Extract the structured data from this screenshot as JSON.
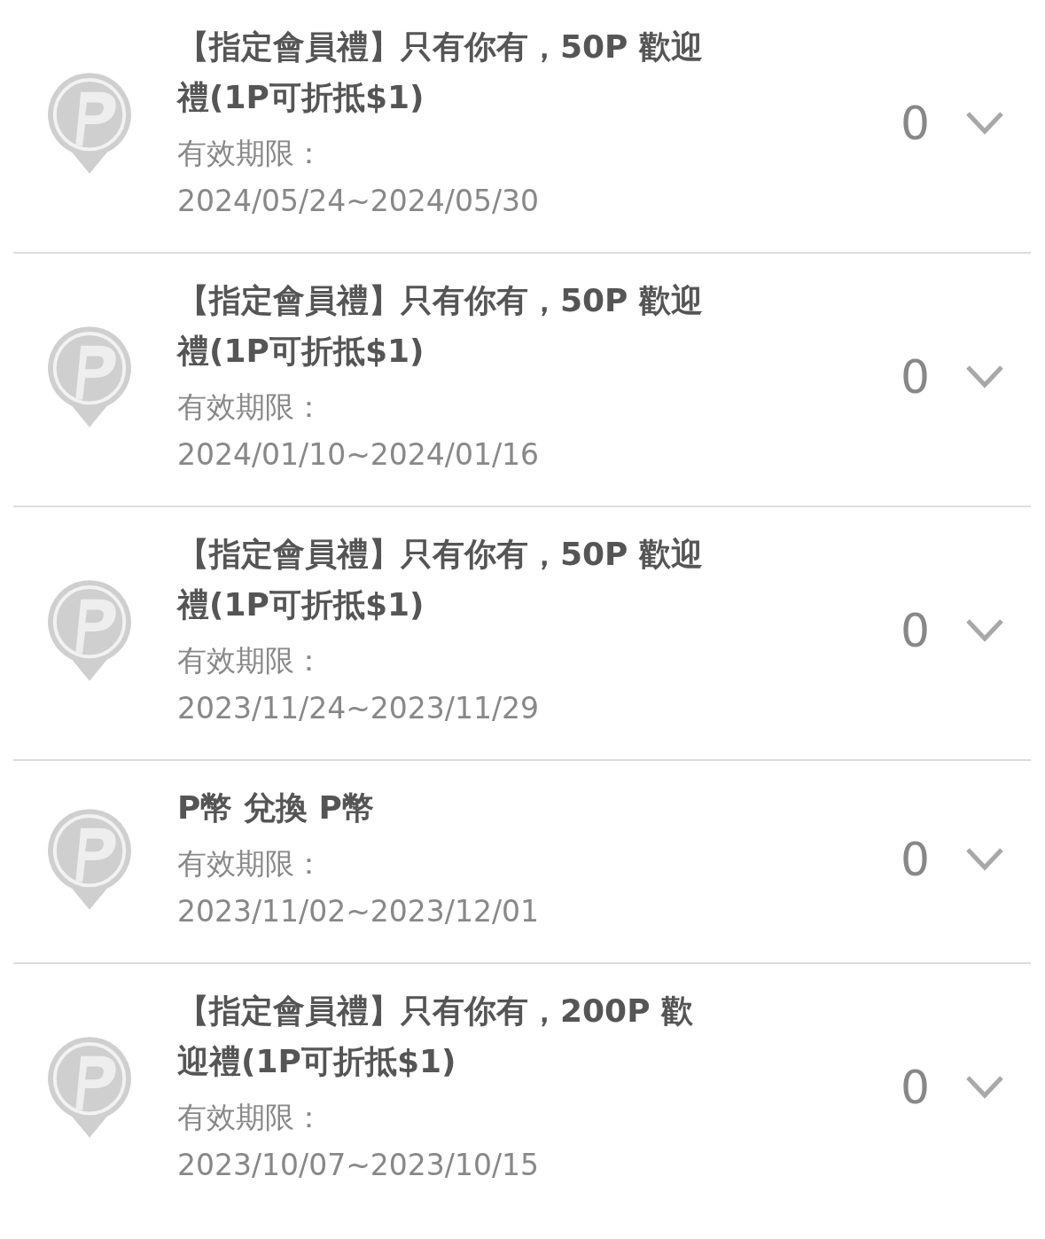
{
  "items": [
    {
      "title": "【指定會員禮】只有你有，50P 歡迎禮(1P可折抵$1)",
      "validity_label": "有效期限：",
      "date_range": "2024/05/24~2024/05/30",
      "count": "0"
    },
    {
      "title": "【指定會員禮】只有你有，50P 歡迎禮(1P可折抵$1)",
      "validity_label": "有效期限：",
      "date_range": "2024/01/10~2024/01/16",
      "count": "0"
    },
    {
      "title": "【指定會員禮】只有你有，50P 歡迎禮(1P可折抵$1)",
      "validity_label": "有效期限：",
      "date_range": "2023/11/24~2023/11/29",
      "count": "0"
    },
    {
      "title": "P幣 兌換 P幣",
      "validity_label": "有效期限：",
      "date_range": "2023/11/02~2023/12/01",
      "count": "0"
    },
    {
      "title": "【指定會員禮】只有你有，200P 歡迎禮(1P可折抵$1)",
      "validity_label": "有效期限：",
      "date_range": "2023/10/07~2023/10/15",
      "count": "0"
    }
  ]
}
